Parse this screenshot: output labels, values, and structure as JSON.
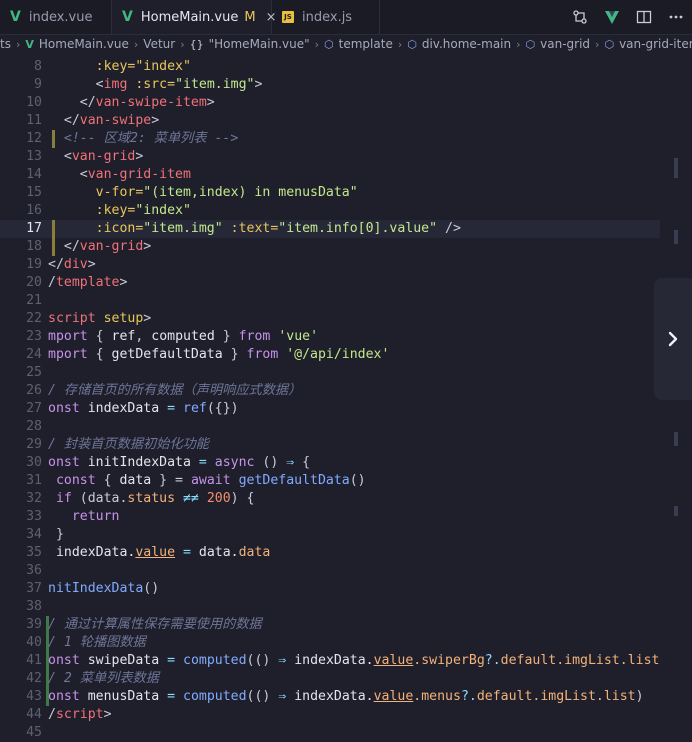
{
  "tabs": [
    {
      "label": "index.vue",
      "type": "vue",
      "active": false
    },
    {
      "label": "HomeMain.vue",
      "type": "vue",
      "active": true,
      "modified": "M",
      "close": "×"
    },
    {
      "label": "index.js",
      "type": "js",
      "active": false
    }
  ],
  "js_icon_text": "JS",
  "vue_icon_text": "V",
  "breadcrumb": [
    {
      "label": "ts",
      "icon": ""
    },
    {
      "label": "HomeMain.vue",
      "icon": "vue"
    },
    {
      "label": "Vetur",
      "icon": ""
    },
    {
      "label": "\"HomeMain.vue\"",
      "icon": "{}"
    },
    {
      "label": "template",
      "icon": "cube"
    },
    {
      "label": "div.home-main",
      "icon": "cube"
    },
    {
      "label": "van-grid",
      "icon": "cube"
    },
    {
      "label": "van-grid-item",
      "icon": "cube"
    }
  ],
  "editor": {
    "current_line": "17",
    "lines": [
      {
        "n": "8",
        "tokens": [
          [
            "      ",
            "p"
          ],
          [
            ":key=\"index\"",
            "a"
          ]
        ]
      },
      {
        "n": "9",
        "tokens": [
          [
            "      ",
            "p"
          ],
          [
            "<",
            "p"
          ],
          [
            "img ",
            "t"
          ],
          [
            ":src=",
            "a"
          ],
          [
            "\"item.img\"",
            "s"
          ],
          [
            ">",
            "p"
          ]
        ]
      },
      {
        "n": "10",
        "tokens": [
          [
            "    </",
            "p"
          ],
          [
            "van-swipe-item",
            "t"
          ],
          [
            ">",
            "p"
          ]
        ]
      },
      {
        "n": "11",
        "tokens": [
          [
            "  </",
            "p"
          ],
          [
            "van-swipe",
            "t"
          ],
          [
            ">",
            "p"
          ]
        ]
      },
      {
        "n": "12",
        "tokens": [
          [
            "  <!-- 区域2: 菜单列表 -->",
            "c"
          ]
        ]
      },
      {
        "n": "13",
        "tokens": [
          [
            "  <",
            "p"
          ],
          [
            "van-grid",
            "t"
          ],
          [
            ">",
            "p"
          ]
        ]
      },
      {
        "n": "14",
        "tokens": [
          [
            "    <",
            "p"
          ],
          [
            "van-grid-item",
            "t"
          ]
        ]
      },
      {
        "n": "15",
        "tokens": [
          [
            "      ",
            "p"
          ],
          [
            "v-for=",
            "a"
          ],
          [
            "\"(item,index) in menusData\"",
            "s"
          ]
        ]
      },
      {
        "n": "16",
        "tokens": [
          [
            "      ",
            "p"
          ],
          [
            ":key=",
            "a"
          ],
          [
            "\"index\"",
            "s"
          ]
        ]
      },
      {
        "n": "17",
        "tokens": [
          [
            "      ",
            "p"
          ],
          [
            ":icon=",
            "a"
          ],
          [
            "\"item.img\" ",
            "s"
          ],
          [
            ":text=",
            "a"
          ],
          [
            "\"item.info[0].value\" ",
            "s"
          ],
          [
            "/>",
            "p"
          ]
        ]
      },
      {
        "n": "18",
        "tokens": [
          [
            "  </",
            "p"
          ],
          [
            "van-grid",
            "t"
          ],
          [
            ">",
            "p"
          ]
        ]
      },
      {
        "n": "19",
        "tokens": [
          [
            "</",
            "p"
          ],
          [
            "div",
            "t"
          ],
          [
            ">",
            "p"
          ]
        ]
      },
      {
        "n": "20",
        "tokens": [
          [
            "/",
            "p"
          ],
          [
            "template",
            "t"
          ],
          [
            ">",
            "p"
          ]
        ]
      },
      {
        "n": "21",
        "tokens": [
          [
            "",
            "p"
          ]
        ]
      },
      {
        "n": "22",
        "tokens": [
          [
            "script ",
            "t"
          ],
          [
            "setup",
            "a"
          ],
          [
            ">",
            "p"
          ]
        ]
      },
      {
        "n": "23",
        "tokens": [
          [
            "mport ",
            "k"
          ],
          [
            "{ ",
            "p"
          ],
          [
            "ref",
            "v"
          ],
          [
            ", ",
            "p"
          ],
          [
            "computed",
            "v"
          ],
          [
            " } ",
            "p"
          ],
          [
            "from ",
            "k"
          ],
          [
            "'vue'",
            "s"
          ]
        ]
      },
      {
        "n": "24",
        "tokens": [
          [
            "mport ",
            "k"
          ],
          [
            "{ ",
            "p"
          ],
          [
            "getDefaultData",
            "v"
          ],
          [
            " } ",
            "p"
          ],
          [
            "from ",
            "k"
          ],
          [
            "'@/api/index'",
            "s"
          ]
        ]
      },
      {
        "n": "25",
        "tokens": [
          [
            "",
            "p"
          ]
        ]
      },
      {
        "n": "26",
        "tokens": [
          [
            "/ 存储首页的所有数据（声明响应式数据）",
            "c"
          ]
        ]
      },
      {
        "n": "27",
        "tokens": [
          [
            "onst ",
            "k"
          ],
          [
            "indexData",
            "v"
          ],
          [
            " = ",
            "o"
          ],
          [
            "ref",
            "f"
          ],
          [
            "({})",
            "p"
          ]
        ]
      },
      {
        "n": "28",
        "tokens": [
          [
            "",
            "p"
          ]
        ]
      },
      {
        "n": "29",
        "tokens": [
          [
            "/ 封装首页数据初始化功能",
            "c"
          ]
        ]
      },
      {
        "n": "30",
        "tokens": [
          [
            "onst ",
            "k"
          ],
          [
            "initIndexData",
            "v"
          ],
          [
            " = ",
            "o"
          ],
          [
            "async ",
            "k"
          ],
          [
            "() ",
            "p"
          ],
          [
            "⇒ ",
            "o"
          ],
          [
            "{",
            "p"
          ]
        ]
      },
      {
        "n": "31",
        "tokens": [
          [
            " const ",
            "k"
          ],
          [
            "{ ",
            "p"
          ],
          [
            "data",
            "v"
          ],
          [
            " } = ",
            "p"
          ],
          [
            "await ",
            "k"
          ],
          [
            "getDefaultData",
            "f"
          ],
          [
            "()",
            "p"
          ]
        ]
      },
      {
        "n": "32",
        "tokens": [
          [
            " if ",
            "k"
          ],
          [
            "(data.",
            "p"
          ],
          [
            "status",
            "r"
          ],
          [
            " ≠≠ ",
            "o"
          ],
          [
            "200",
            "n"
          ],
          [
            ") {",
            "p"
          ]
        ]
      },
      {
        "n": "33",
        "tokens": [
          [
            "   return",
            "k"
          ]
        ]
      },
      {
        "n": "34",
        "tokens": [
          [
            " }",
            "p"
          ]
        ]
      },
      {
        "n": "35",
        "tokens": [
          [
            " indexData.",
            "v"
          ],
          [
            "value",
            "u"
          ],
          [
            " = ",
            "o"
          ],
          [
            "data.",
            "v"
          ],
          [
            "data",
            "r"
          ]
        ]
      },
      {
        "n": "36",
        "tokens": [
          [
            "",
            "p"
          ]
        ]
      },
      {
        "n": "37",
        "tokens": [
          [
            "nitIndexData",
            "f"
          ],
          [
            "()",
            "p"
          ]
        ]
      },
      {
        "n": "38",
        "tokens": [
          [
            "",
            "p"
          ]
        ]
      },
      {
        "n": "39",
        "tokens": [
          [
            "/ 通过计算属性保存需要使用的数据",
            "c"
          ]
        ]
      },
      {
        "n": "40",
        "tokens": [
          [
            "/ 1 轮播图数据",
            "c"
          ]
        ]
      },
      {
        "n": "41",
        "tokens": [
          [
            "onst ",
            "k"
          ],
          [
            "swipeData",
            "v"
          ],
          [
            " = ",
            "o"
          ],
          [
            "computed",
            "f"
          ],
          [
            "(() ",
            "p"
          ],
          [
            "⇒ ",
            "o"
          ],
          [
            "indexData.",
            "v"
          ],
          [
            "value",
            "u"
          ],
          [
            ".swiperBg",
            "r"
          ],
          [
            "?.",
            "o"
          ],
          [
            "default.imgList.list",
            "r"
          ]
        ]
      },
      {
        "n": "42",
        "tokens": [
          [
            "/ 2 菜单列表数据",
            "c"
          ]
        ]
      },
      {
        "n": "43",
        "tokens": [
          [
            "onst ",
            "k"
          ],
          [
            "menusData",
            "v"
          ],
          [
            " = ",
            "o"
          ],
          [
            "computed",
            "f"
          ],
          [
            "(() ",
            "p"
          ],
          [
            "⇒ ",
            "o"
          ],
          [
            "indexData.",
            "v"
          ],
          [
            "value",
            "u"
          ],
          [
            ".menus",
            "r"
          ],
          [
            "?.",
            "o"
          ],
          [
            "default.imgList.list",
            "r"
          ],
          [
            ")",
            "p"
          ]
        ]
      },
      {
        "n": "44",
        "tokens": [
          [
            "/",
            "p"
          ],
          [
            "script",
            "t"
          ],
          [
            ">",
            "p"
          ]
        ]
      },
      {
        "n": "45",
        "tokens": [
          [
            "",
            "p"
          ]
        ]
      }
    ]
  },
  "colors": {
    "tag": "#f07178",
    "attr": "#e8c75a",
    "string": "#c3e88d",
    "keyword": "#c792ea",
    "function": "#82aaff",
    "comment": "#6f7598",
    "accent_vue": "#41b883"
  },
  "icons": [
    "vue-file-icon",
    "js-file-icon",
    "close-icon",
    "compare-changes-icon",
    "vue-preview-icon",
    "split-editor-icon",
    "more-actions-icon",
    "chevron-right-icon"
  ]
}
